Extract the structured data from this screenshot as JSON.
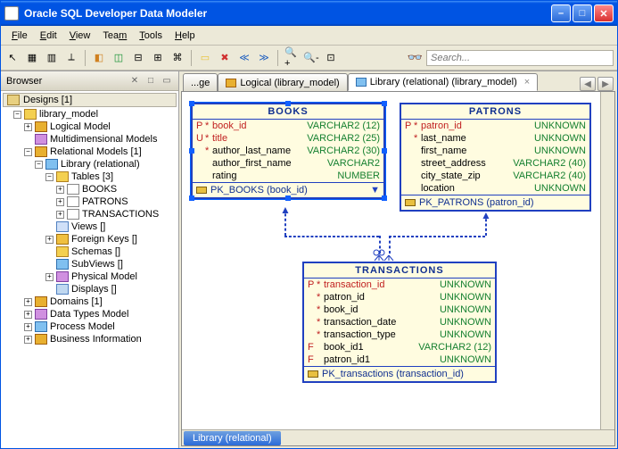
{
  "window": {
    "title": "Oracle SQL Developer Data Modeler"
  },
  "menu": {
    "file": "File",
    "edit": "Edit",
    "view": "View",
    "team": "Team",
    "tools": "Tools",
    "help": "Help"
  },
  "search": {
    "placeholder": "Search..."
  },
  "browser": {
    "title": "Browser",
    "designs": "Designs [1]",
    "root": "library_model",
    "logical": "Logical Model",
    "multidim": "Multidimensional Models",
    "relational": "Relational Models [1]",
    "library_rel": "Library (relational)",
    "tables": "Tables [3]",
    "t_books": "BOOKS",
    "t_patrons": "PATRONS",
    "t_trans": "TRANSACTIONS",
    "views": "Views []",
    "fkeys": "Foreign Keys []",
    "schemas": "Schemas []",
    "subviews": "SubViews []",
    "physical": "Physical Model",
    "displays": "Displays []",
    "domains": "Domains [1]",
    "datatypes": "Data Types Model",
    "process": "Process Model",
    "business": "Business Information"
  },
  "tabs": {
    "t1": "...ge",
    "t2": "Logical (library_model)",
    "t3": "Library (relational) (library_model)",
    "bottom": "Library (relational)"
  },
  "books": {
    "title": "BOOKS",
    "cols": [
      {
        "flag": "P",
        "star": "*",
        "name": "book_id",
        "type": "VARCHAR2 (12)",
        "pk": true
      },
      {
        "flag": "U",
        "star": "*",
        "name": "title",
        "type": "VARCHAR2 (25)",
        "u": true
      },
      {
        "flag": "",
        "star": "*",
        "name": "author_last_name",
        "type": "VARCHAR2 (30)"
      },
      {
        "flag": "",
        "star": "",
        "name": "author_first_name",
        "type": "VARCHAR2"
      },
      {
        "flag": "",
        "star": "",
        "name": "rating",
        "type": "NUMBER"
      }
    ],
    "pk": "PK_BOOKS (book_id)"
  },
  "patrons": {
    "title": "PATRONS",
    "cols": [
      {
        "flag": "P",
        "star": "*",
        "name": "patron_id",
        "type": "UNKNOWN",
        "pk": true
      },
      {
        "flag": "",
        "star": "*",
        "name": "last_name",
        "type": "UNKNOWN"
      },
      {
        "flag": "",
        "star": "",
        "name": "first_name",
        "type": "UNKNOWN"
      },
      {
        "flag": "",
        "star": "",
        "name": "street_address",
        "type": "VARCHAR2 (40)"
      },
      {
        "flag": "",
        "star": "",
        "name": "city_state_zip",
        "type": "VARCHAR2 (40)"
      },
      {
        "flag": "",
        "star": "",
        "name": "location",
        "type": "UNKNOWN"
      }
    ],
    "pk": "PK_PATRONS (patron_id)"
  },
  "transactions": {
    "title": "TRANSACTIONS",
    "cols": [
      {
        "flag": "P",
        "star": "*",
        "name": "transaction_id",
        "type": "UNKNOWN",
        "pk": true
      },
      {
        "flag": "",
        "star": "*",
        "name": "patron_id",
        "type": "UNKNOWN"
      },
      {
        "flag": "",
        "star": "*",
        "name": "book_id",
        "type": "UNKNOWN"
      },
      {
        "flag": "",
        "star": "*",
        "name": "transaction_date",
        "type": "UNKNOWN"
      },
      {
        "flag": "",
        "star": "*",
        "name": "transaction_type",
        "type": "UNKNOWN"
      },
      {
        "flag": "F",
        "star": "",
        "name": "book_id1",
        "type": "VARCHAR2 (12)"
      },
      {
        "flag": "F",
        "star": "",
        "name": "patron_id1",
        "type": "UNKNOWN"
      }
    ],
    "pk": "PK_transactions (transaction_id)"
  }
}
